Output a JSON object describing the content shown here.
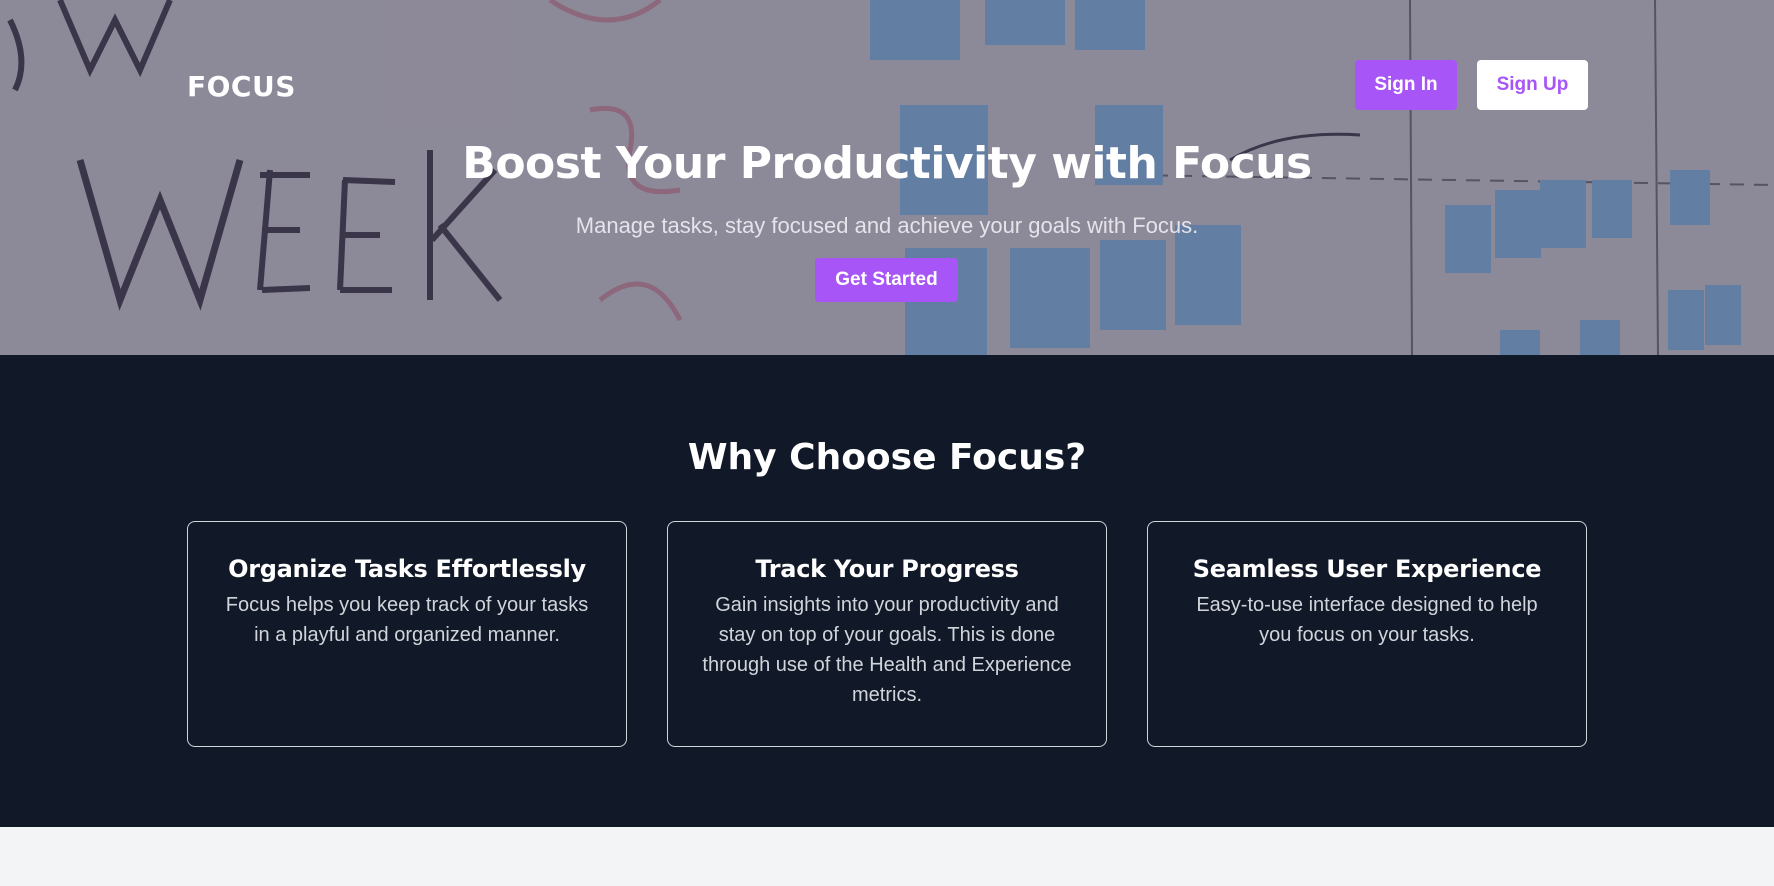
{
  "header": {
    "brand": "FOCUS",
    "sign_in_label": "Sign In",
    "sign_up_label": "Sign Up"
  },
  "hero": {
    "title": "Boost Your Productivity with Focus",
    "subtitle": "Manage tasks, stay focused and achieve your goals with Focus.",
    "cta_label": "Get Started"
  },
  "features": {
    "title": "Why Choose Focus?",
    "cards": [
      {
        "title": "Organize Tasks Effortlessly",
        "text": "Focus helps you keep track of your tasks in a playful and organized manner."
      },
      {
        "title": "Track Your Progress",
        "text": "Gain insights into your productivity and stay on top of your goals. This is done through use of the Health and Experience metrics."
      },
      {
        "title": "Seamless User Experience",
        "text": "Easy-to-use interface designed to help you focus on your tasks."
      }
    ]
  },
  "colors": {
    "accent": "#a855f7",
    "dark_section": "#111827",
    "light_footer": "#f3f4f6"
  }
}
